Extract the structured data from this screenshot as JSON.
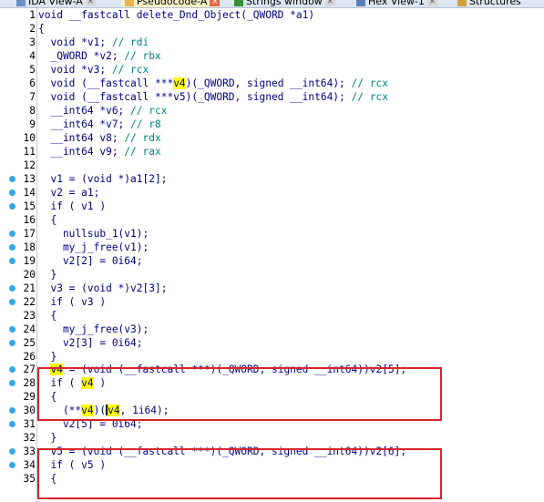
{
  "tabs": [
    {
      "label": "IDA View-A",
      "icon": "ida-view-icon",
      "active": false,
      "close": "×"
    },
    {
      "label": "Pseudocode-A",
      "icon": "pseudocode-icon",
      "active": true,
      "close": "×"
    },
    {
      "label": "Strings window",
      "icon": "strings-icon",
      "active": false,
      "close": "×"
    },
    {
      "label": "Hex View-1",
      "icon": "hex-view-icon",
      "active": false,
      "close": "×"
    },
    {
      "label": "Structures",
      "icon": "structures-icon",
      "active": false,
      "close": ""
    }
  ],
  "code_lines": [
    {
      "n": "1",
      "dot": false,
      "parts": [
        {
          "t": "void __fastcall delete_Dnd_Object(_QWORD *a1)"
        }
      ]
    },
    {
      "n": "2",
      "dot": false,
      "parts": [
        {
          "t": "{"
        }
      ]
    },
    {
      "n": "3",
      "dot": false,
      "parts": [
        {
          "t": "  void *v1; "
        },
        {
          "t": "// rdi",
          "c": "cm"
        }
      ]
    },
    {
      "n": "4",
      "dot": false,
      "parts": [
        {
          "t": "  _QWORD *v2; "
        },
        {
          "t": "// rbx",
          "c": "cm"
        }
      ]
    },
    {
      "n": "5",
      "dot": false,
      "parts": [
        {
          "t": "  void *v3; "
        },
        {
          "t": "// rcx",
          "c": "cm"
        }
      ]
    },
    {
      "n": "6",
      "dot": false,
      "parts": [
        {
          "t": "  void (__fastcall ***"
        },
        {
          "t": "v4",
          "c": "hl"
        },
        {
          "t": ")(_QWORD, signed __int64); "
        },
        {
          "t": "// rcx",
          "c": "cm"
        }
      ]
    },
    {
      "n": "7",
      "dot": false,
      "parts": [
        {
          "t": "  void (__fastcall ***v5)(_QWORD, signed __int64); "
        },
        {
          "t": "// rcx",
          "c": "cm"
        }
      ]
    },
    {
      "n": "8",
      "dot": false,
      "parts": [
        {
          "t": "  __int64 *v6; "
        },
        {
          "t": "// rcx",
          "c": "cm"
        }
      ]
    },
    {
      "n": "9",
      "dot": false,
      "parts": [
        {
          "t": "  __int64 *v7; "
        },
        {
          "t": "// r8",
          "c": "cm"
        }
      ]
    },
    {
      "n": "10",
      "dot": false,
      "parts": [
        {
          "t": "  __int64 v8; "
        },
        {
          "t": "// rdx",
          "c": "cm"
        }
      ]
    },
    {
      "n": "11",
      "dot": false,
      "parts": [
        {
          "t": "  __int64 v9; "
        },
        {
          "t": "// rax",
          "c": "cm"
        }
      ]
    },
    {
      "n": "12",
      "dot": false,
      "parts": [
        {
          "t": ""
        }
      ]
    },
    {
      "n": "13",
      "dot": true,
      "parts": [
        {
          "t": "  v1 = (void *)a1[2];"
        }
      ]
    },
    {
      "n": "14",
      "dot": true,
      "parts": [
        {
          "t": "  v2 = a1;"
        }
      ]
    },
    {
      "n": "15",
      "dot": true,
      "parts": [
        {
          "t": "  if ( v1 )"
        }
      ]
    },
    {
      "n": "16",
      "dot": false,
      "parts": [
        {
          "t": "  {"
        }
      ]
    },
    {
      "n": "17",
      "dot": true,
      "parts": [
        {
          "t": "    nullsub_1(v1);"
        }
      ]
    },
    {
      "n": "18",
      "dot": true,
      "parts": [
        {
          "t": "    my_j_free(v1);"
        }
      ]
    },
    {
      "n": "19",
      "dot": true,
      "parts": [
        {
          "t": "    v2[2] = 0i64;"
        }
      ]
    },
    {
      "n": "20",
      "dot": false,
      "parts": [
        {
          "t": "  }"
        }
      ]
    },
    {
      "n": "21",
      "dot": true,
      "parts": [
        {
          "t": "  v3 = (void *)v2[3];"
        }
      ]
    },
    {
      "n": "22",
      "dot": true,
      "parts": [
        {
          "t": "  if ( v3 )"
        }
      ]
    },
    {
      "n": "23",
      "dot": false,
      "parts": [
        {
          "t": "  {"
        }
      ]
    },
    {
      "n": "24",
      "dot": true,
      "parts": [
        {
          "t": "    my_j_free(v3);"
        }
      ]
    },
    {
      "n": "25",
      "dot": true,
      "parts": [
        {
          "t": "    v2[3] = 0i64;"
        }
      ]
    },
    {
      "n": "26",
      "dot": false,
      "parts": [
        {
          "t": "  }"
        }
      ]
    },
    {
      "n": "27",
      "dot": true,
      "parts": [
        {
          "t": "  "
        },
        {
          "t": "v4",
          "c": "hl"
        },
        {
          "t": " = (void (__fastcall ***)(_QWORD, signed __int64))v2[5];"
        }
      ]
    },
    {
      "n": "28",
      "dot": true,
      "parts": [
        {
          "t": "  if ( "
        },
        {
          "t": "v4",
          "c": "hl"
        },
        {
          "t": " )"
        }
      ]
    },
    {
      "n": "29",
      "dot": false,
      "parts": [
        {
          "t": "  {"
        }
      ]
    },
    {
      "n": "30",
      "dot": true,
      "parts": [
        {
          "t": "    (**"
        },
        {
          "t": "v4",
          "c": "hl"
        },
        {
          "t": ")("
        },
        {
          "t": "",
          "c": "cursor"
        },
        {
          "t": "v4",
          "c": "hl"
        },
        {
          "t": ", 1i64);"
        }
      ]
    },
    {
      "n": "31",
      "dot": true,
      "parts": [
        {
          "t": "    v2[5] = 0i64;"
        }
      ]
    },
    {
      "n": "32",
      "dot": false,
      "parts": [
        {
          "t": "  }"
        }
      ]
    },
    {
      "n": "33",
      "dot": true,
      "parts": [
        {
          "t": "  v5 = (void (__fastcall ***)(_QWORD, signed __int64))v2[6];"
        }
      ]
    },
    {
      "n": "34",
      "dot": true,
      "parts": [
        {
          "t": "  if ( v5 )"
        }
      ]
    },
    {
      "n": "35",
      "dot": false,
      "parts": [
        {
          "t": "  {"
        }
      ]
    }
  ],
  "colors": {
    "highlight": "#ffff00",
    "annotation_box": "#d8232a",
    "line_dot": "#35a8e8",
    "code": "#000080",
    "comment": "#008080"
  }
}
